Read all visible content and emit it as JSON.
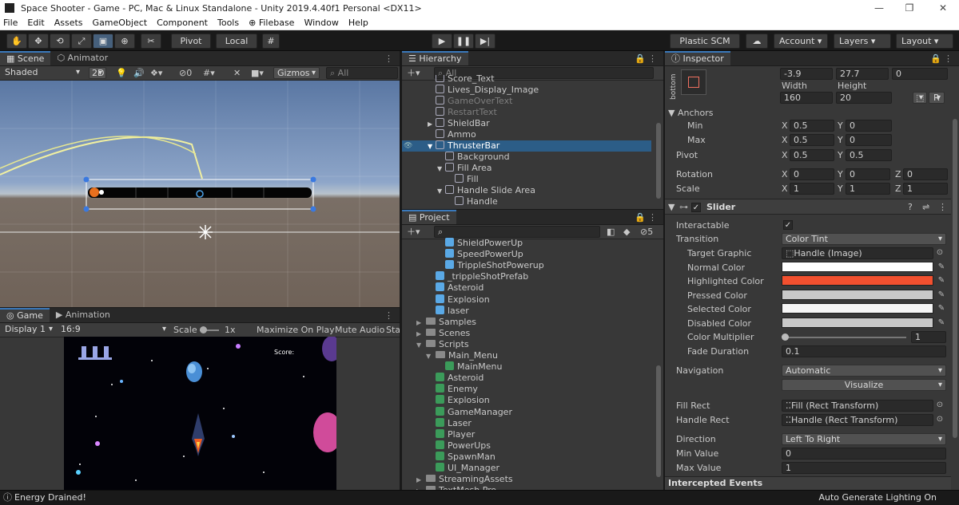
{
  "window": {
    "title": "Space Shooter - Game - PC, Mac & Linux Standalone - Unity 2019.4.40f1 Personal <DX11>"
  },
  "menu": [
    "File",
    "Edit",
    "Assets",
    "GameObject",
    "Component",
    "Tools",
    "⊕ Filebase",
    "Window",
    "Help"
  ],
  "toolbar": {
    "pivot": "Pivot",
    "local": "Local",
    "plastic": "Plastic SCM",
    "account": "Account",
    "layers": "Layers",
    "layout": "Layout"
  },
  "scene": {
    "tab_scene": "Scene",
    "tab_animator": "Animator",
    "shading": "Shaded",
    "mode_2d": "2D",
    "fx_count": "0",
    "gizmos": "Gizmos",
    "search_placeholder": "All"
  },
  "game": {
    "tab_game": "Game",
    "tab_animation": "Animation",
    "display": "Display 1",
    "aspect": "16:9",
    "scale_label": "Scale",
    "scale_value": "1x",
    "maximize": "Maximize On Play",
    "mute": "Mute Audio",
    "stats": "Sta",
    "score_label": "Score:"
  },
  "hierarchy": {
    "title": "Hierarchy",
    "search_placeholder": "All",
    "items": [
      {
        "label": "Score_Text",
        "indent": 1,
        "dim": false
      },
      {
        "label": "Lives_Display_Image",
        "indent": 1,
        "dim": false
      },
      {
        "label": "GameOverText",
        "indent": 1,
        "dim": true
      },
      {
        "label": "RestartText",
        "indent": 1,
        "dim": true
      },
      {
        "label": "ShieldBar",
        "indent": 1,
        "dim": false,
        "arrow": "▶"
      },
      {
        "label": "Ammo",
        "indent": 1,
        "dim": false
      },
      {
        "label": "ThrusterBar",
        "indent": 1,
        "dim": false,
        "arrow": "▼",
        "selected": true
      },
      {
        "label": "Background",
        "indent": 2,
        "dim": false
      },
      {
        "label": "Fill Area",
        "indent": 2,
        "dim": false,
        "arrow": "▼"
      },
      {
        "label": "Fill",
        "indent": 3,
        "dim": false
      },
      {
        "label": "Handle Slide Area",
        "indent": 2,
        "dim": false,
        "arrow": "▼"
      },
      {
        "label": "Handle",
        "indent": 3,
        "dim": false
      }
    ]
  },
  "project": {
    "title": "Project",
    "hidden_count": "5",
    "items": [
      {
        "label": "ShieldPowerUp",
        "indent": 3,
        "icon": "prefab"
      },
      {
        "label": "SpeedPowerUp",
        "indent": 3,
        "icon": "prefab"
      },
      {
        "label": "TrippleShotPowerup",
        "indent": 3,
        "icon": "prefab"
      },
      {
        "label": "_trippleShotPrefab",
        "indent": 2,
        "icon": "prefab"
      },
      {
        "label": "Asteroid",
        "indent": 2,
        "icon": "prefab"
      },
      {
        "label": "Explosion",
        "indent": 2,
        "icon": "prefab"
      },
      {
        "label": "laser",
        "indent": 2,
        "icon": "prefab"
      },
      {
        "label": "Samples",
        "indent": 1,
        "icon": "folder",
        "arrow": "▶"
      },
      {
        "label": "Scenes",
        "indent": 1,
        "icon": "folder",
        "arrow": "▶"
      },
      {
        "label": "Scripts",
        "indent": 1,
        "icon": "folder",
        "arrow": "▼"
      },
      {
        "label": "Main_Menu",
        "indent": 2,
        "icon": "folder",
        "arrow": "▼"
      },
      {
        "label": "MainMenu",
        "indent": 3,
        "icon": "script"
      },
      {
        "label": "Asteroid",
        "indent": 2,
        "icon": "script"
      },
      {
        "label": "Enemy",
        "indent": 2,
        "icon": "script"
      },
      {
        "label": "Explosion",
        "indent": 2,
        "icon": "script"
      },
      {
        "label": "GameManager",
        "indent": 2,
        "icon": "script"
      },
      {
        "label": "Laser",
        "indent": 2,
        "icon": "script"
      },
      {
        "label": "Player",
        "indent": 2,
        "icon": "script"
      },
      {
        "label": "PowerUps",
        "indent": 2,
        "icon": "script"
      },
      {
        "label": "SpawnMan",
        "indent": 2,
        "icon": "script"
      },
      {
        "label": "UI_Manager",
        "indent": 2,
        "icon": "script"
      },
      {
        "label": "StreamingAssets",
        "indent": 1,
        "icon": "folder",
        "arrow": "▶"
      },
      {
        "label": "TextMesh Pro",
        "indent": 1,
        "icon": "folder",
        "arrow": "▶"
      }
    ]
  },
  "inspector": {
    "title": "Inspector",
    "anchor_preset_label": "bottom",
    "pos_x": "-3.9",
    "pos_y": "27.7",
    "pos_z": "0",
    "width_label": "Width",
    "height_label": "Height",
    "width": "160",
    "height": "20",
    "r_button": "R",
    "anchors_label": "Anchors",
    "min_label": "Min",
    "max_label": "Max",
    "anchor_min_x": "0.5",
    "anchor_min_y": "0",
    "anchor_max_x": "0.5",
    "anchor_max_y": "0",
    "pivot_label": "Pivot",
    "pivot_x": "0.5",
    "pivot_y": "0.5",
    "rotation_label": "Rotation",
    "rot_x": "0",
    "rot_y": "0",
    "rot_z": "0",
    "scale_label": "Scale",
    "scale_x": "1",
    "scale_y": "1",
    "scale_z": "1",
    "x": "X",
    "y": "Y",
    "z": "Z",
    "slider_title": "Slider",
    "interactable_label": "Interactable",
    "transition_label": "Transition",
    "transition": "Color Tint",
    "target_graphic_label": "Target Graphic",
    "target_graphic": "Handle (Image)",
    "normal_color_label": "Normal Color",
    "highlighted_color_label": "Highlighted Color",
    "pressed_color_label": "Pressed Color",
    "selected_color_label": "Selected Color",
    "disabled_color_label": "Disabled Color",
    "color_multiplier_label": "Color Multiplier",
    "color_multiplier": "1",
    "fade_duration_label": "Fade Duration",
    "fade_duration": "0.1",
    "navigation_label": "Navigation",
    "navigation": "Automatic",
    "visualize": "Visualize",
    "fill_rect_label": "Fill Rect",
    "fill_rect": "Fill (Rect Transform)",
    "handle_rect_label": "Handle Rect",
    "handle_rect": "Handle (Rect Transform)",
    "direction_label": "Direction",
    "direction": "Left To Right",
    "min_value_label": "Min Value",
    "min_value": "0",
    "max_value_label": "Max Value",
    "max_value": "1",
    "intercepted_events": "Intercepted Events"
  },
  "colors": {
    "normal": "#ffffff",
    "highlighted": "#f2502f",
    "pressed": "#c8c8c8",
    "selected": "#f5f5f5",
    "disabled": "#c8c8c8",
    "accent": "#3a79bb"
  },
  "status": {
    "message": "Energy Drained!",
    "lighting": "Auto Generate Lighting On"
  }
}
